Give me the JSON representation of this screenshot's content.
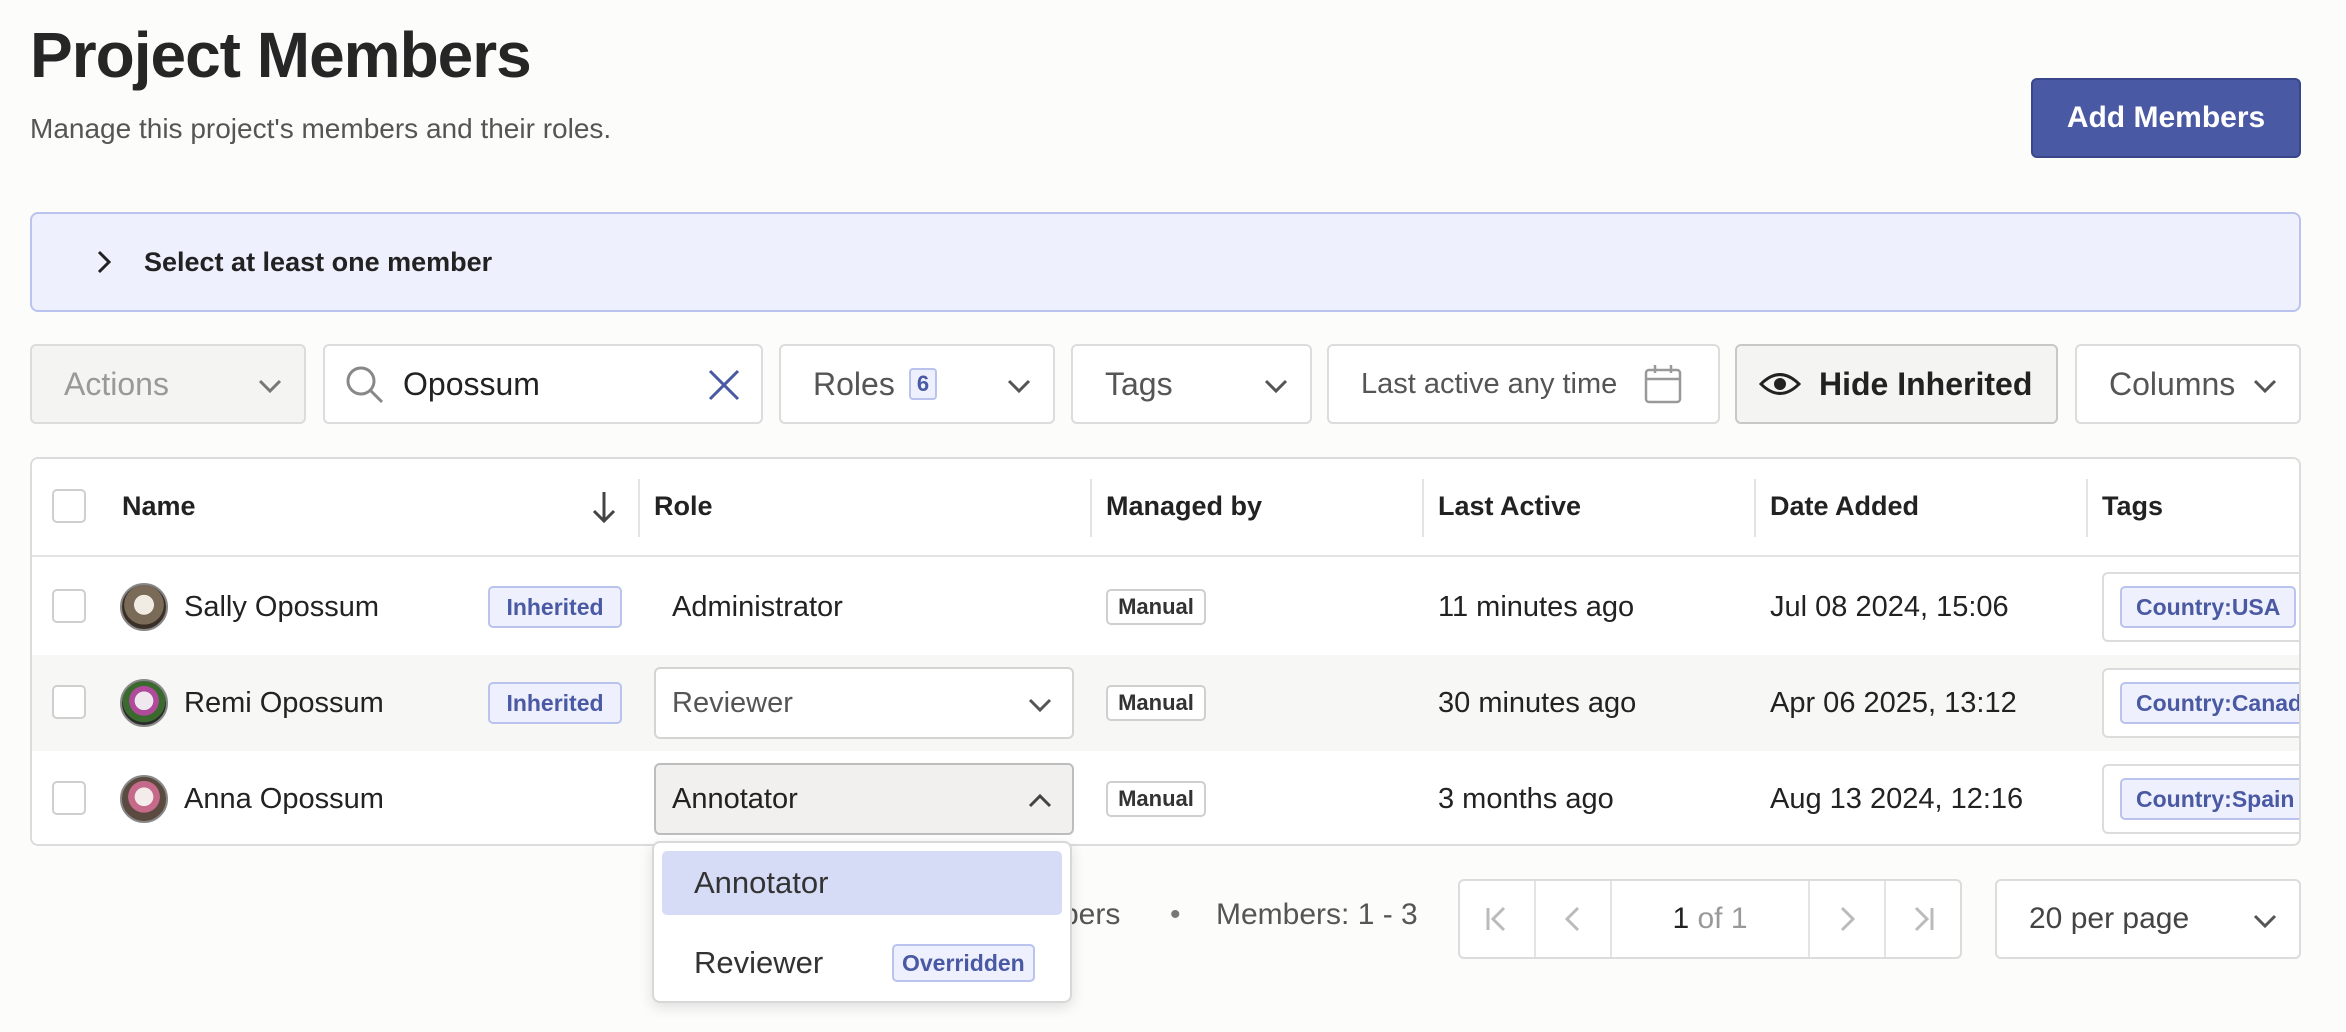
{
  "header": {
    "title": "Project Members",
    "subtitle": "Manage this project's members and their roles.",
    "add_button": "Add Members"
  },
  "notice": {
    "text": "Select at least one member"
  },
  "toolbar": {
    "actions": "Actions",
    "search_value": "Opossum",
    "roles_label": "Roles",
    "roles_count": "6",
    "tags_label": "Tags",
    "last_active_label": "Last active any time",
    "hide_inherited": "Hide Inherited",
    "columns": "Columns"
  },
  "table": {
    "columns": [
      "Name",
      "Role",
      "Managed by",
      "Last Active",
      "Date Added",
      "Tags"
    ],
    "rows": [
      {
        "name": "Sally Opossum",
        "badge": "Inherited",
        "role": "Administrator",
        "managed": "Manual",
        "last_active": "11 minutes ago",
        "date_added": "Jul 08 2024, 15:06",
        "tag": "Country:USA"
      },
      {
        "name": "Remi Opossum",
        "badge": "Inherited",
        "role": "Reviewer",
        "managed": "Manual",
        "last_active": "30 minutes ago",
        "date_added": "Apr 06 2025, 13:12",
        "tag": "Country:Canada"
      },
      {
        "name": "Anna Opossum",
        "badge": "",
        "role": "Annotator",
        "managed": "Manual",
        "last_active": "3 months ago",
        "date_added": "Aug 13 2024, 12:16",
        "tag": "Country:Spain"
      }
    ]
  },
  "footer": {
    "members_partial": "bers",
    "bullet": "•",
    "range": "Members: 1 - 3",
    "page_current": "1",
    "page_of": "of 1",
    "per_page": "20 per page"
  },
  "dropdown": {
    "items": [
      {
        "label": "Annotator",
        "badge": ""
      },
      {
        "label": "Reviewer",
        "badge": "Overridden"
      }
    ]
  },
  "colors": {
    "accent": "#4a59a3",
    "notice_bg": "#eef0fd",
    "badge_bg": "#eef0fd",
    "menu_selected": "#d6dbf6"
  }
}
